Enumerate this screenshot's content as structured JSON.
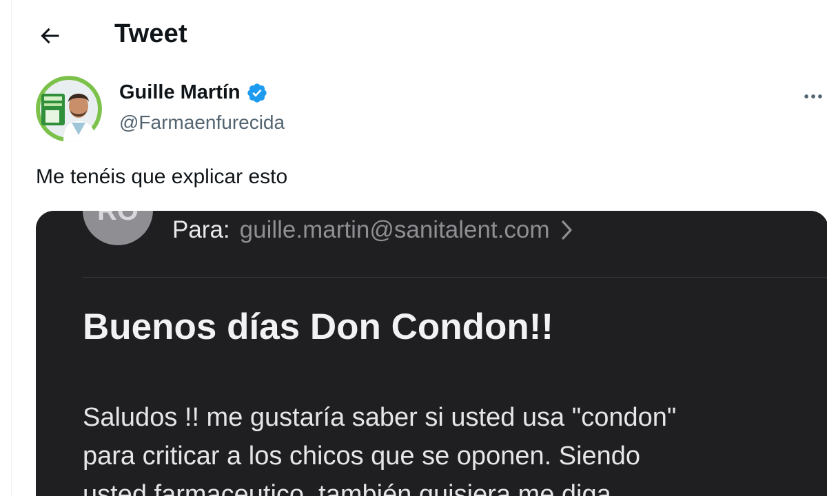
{
  "header": {
    "title": "Tweet",
    "back_icon": "arrow-left-icon"
  },
  "author": {
    "display_name": "Guille Martín",
    "handle": "@Farmaenfurecida",
    "verified": true,
    "verified_icon": "verified-badge-icon",
    "more_icon": "more-horizontal-icon"
  },
  "tweet": {
    "text": "Me tenéis que explicar esto"
  },
  "media": {
    "email": {
      "sender_initials": "RO",
      "to_label": "Para:",
      "to_address": "guille.martin@sanitalent.com",
      "subject": "Buenos días Don Condon!!",
      "body_lines": [
        "Saludos !! me gustaría saber si usted usa \"condon\"",
        "para criticar a los chicos que se oponen. Siendo",
        "usted farmaceutico, también quisiera me diga"
      ]
    }
  },
  "colors": {
    "text_primary": "#0f1419",
    "text_secondary": "#536471",
    "verified_blue": "#1d9bf0",
    "email_background": "#1f1f21"
  }
}
